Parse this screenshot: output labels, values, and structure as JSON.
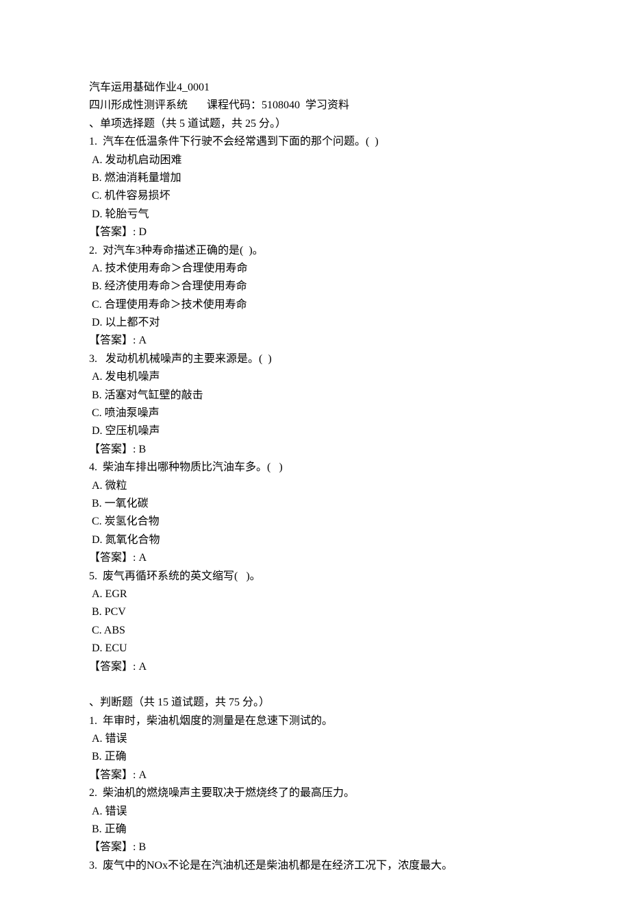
{
  "header": {
    "title": "汽车运用基础作业4_0001",
    "subtitle": "四川形成性测评系统       课程代码：5108040  学习资料"
  },
  "section1": {
    "heading": "、单项选择题（共 5 道试题，共 25 分。）",
    "questions": [
      {
        "num": "1.",
        "text": "  汽车在低温条件下行驶不会经常遇到下面的那个问题。(  )",
        "options": [
          " A. 发动机启动困难",
          " B. 燃油消耗量增加",
          " C. 机件容易损坏",
          " D. 轮胎亏气"
        ],
        "answer": "【答案】: D"
      },
      {
        "num": "2.",
        "text": "  对汽车3种寿命描述正确的是(  )。",
        "options": [
          " A. 技术使用寿命＞合理使用寿命",
          " B. 经济使用寿命＞合理使用寿命",
          " C. 合理使用寿命＞技术使用寿命",
          " D. 以上都不对"
        ],
        "answer": "【答案】: A"
      },
      {
        "num": "3.",
        "text": "   发动机机械噪声的主要来源是。(  )",
        "options": [
          " A. 发电机噪声",
          " B. 活塞对气缸壁的敲击",
          " C. 喷油泵噪声",
          " D. 空压机噪声"
        ],
        "answer": "【答案】: B"
      },
      {
        "num": "4.",
        "text": "  柴油车排出哪种物质比汽油车多。(   )",
        "options": [
          " A. 微粒",
          " B. 一氧化碳",
          " C. 炭氢化合物",
          " D. 氮氧化合物"
        ],
        "answer": "【答案】: A"
      },
      {
        "num": "5.",
        "text": "  废气再循环系统的英文缩写(   )。",
        "options": [
          " A. EGR",
          " B. PCV",
          " C. ABS",
          " D. ECU"
        ],
        "answer": "【答案】: A"
      }
    ]
  },
  "section2": {
    "heading": "、判断题（共 15 道试题，共 75 分。）",
    "questions": [
      {
        "num": "1.",
        "text": "  年审时，柴油机烟度的测量是在怠速下测试的。",
        "options": [
          " A. 错误",
          " B. 正确"
        ],
        "answer": "【答案】: A"
      },
      {
        "num": "2.",
        "text": "  柴油机的燃烧噪声主要取决于燃烧终了的最高压力。",
        "options": [
          " A. 错误",
          " B. 正确"
        ],
        "answer": "【答案】: B"
      },
      {
        "num": "3.",
        "text": "  废气中的NOx不论是在汽油机还是柴油机都是在经济工况下，浓度最大。",
        "options": [],
        "answer": ""
      }
    ]
  }
}
